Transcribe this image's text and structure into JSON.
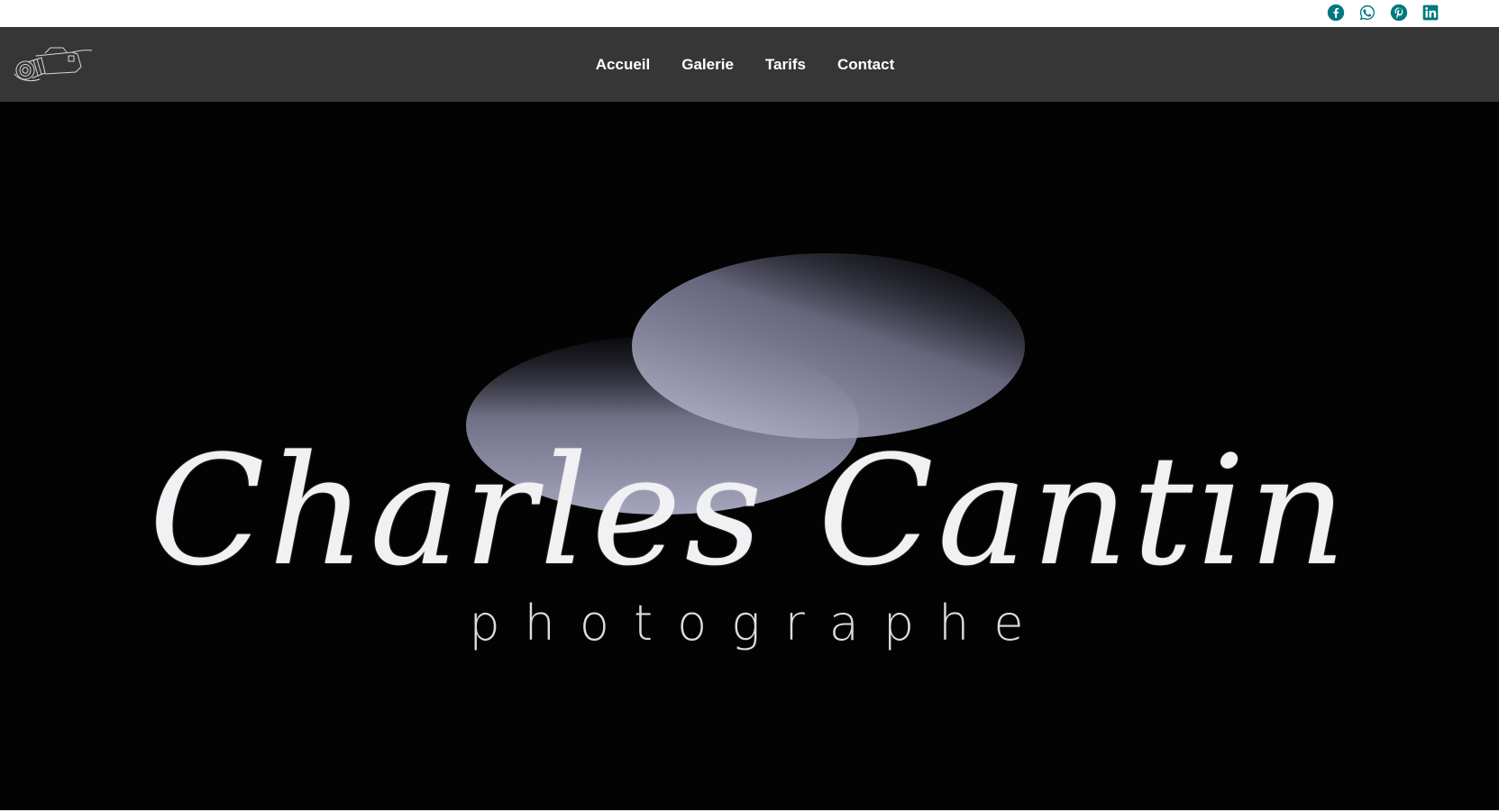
{
  "social": {
    "accent_color": "#00787f",
    "items": [
      {
        "icon": "facebook-icon"
      },
      {
        "icon": "whatsapp-icon"
      },
      {
        "icon": "pinterest-icon"
      },
      {
        "icon": "linkedin-icon"
      }
    ]
  },
  "header": {
    "logo_icon": "camera-sketch-icon",
    "nav": [
      {
        "label": "Accueil"
      },
      {
        "label": "Galerie"
      },
      {
        "label": "Tarifs"
      },
      {
        "label": "Contact"
      }
    ]
  },
  "hero": {
    "title": "Charles Cantin",
    "subtitle": "photographe",
    "background_color": "#030304",
    "circle_color": "#9c9cb3"
  }
}
